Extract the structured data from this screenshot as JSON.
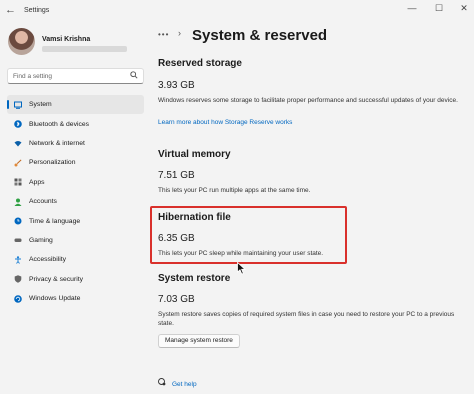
{
  "window": {
    "title": "Settings",
    "back": "←",
    "minimize": "—",
    "maximize": "☐",
    "close": "✕"
  },
  "profile": {
    "name": "Vamsi Krishna"
  },
  "search": {
    "placeholder": "Find a setting",
    "icon": "search-icon"
  },
  "sidebar": {
    "items": [
      {
        "label": "System",
        "icon": "system-icon",
        "color": "#0067c0"
      },
      {
        "label": "Bluetooth & devices",
        "icon": "bluetooth-icon",
        "color": "#0067c0"
      },
      {
        "label": "Network & internet",
        "icon": "wifi-icon",
        "color": "#0a5fa8"
      },
      {
        "label": "Personalization",
        "icon": "brush-icon",
        "color": "#c2691f"
      },
      {
        "label": "Apps",
        "icon": "apps-icon",
        "color": "#555555"
      },
      {
        "label": "Accounts",
        "icon": "person-icon",
        "color": "#2ea043"
      },
      {
        "label": "Time & language",
        "icon": "globe-clock-icon",
        "color": "#0067c0"
      },
      {
        "label": "Gaming",
        "icon": "controller-icon",
        "color": "#666666"
      },
      {
        "label": "Accessibility",
        "icon": "accessibility-icon",
        "color": "#1a7fd4"
      },
      {
        "label": "Privacy & security",
        "icon": "shield-icon",
        "color": "#666666"
      },
      {
        "label": "Windows Update",
        "icon": "update-icon",
        "color": "#0067c0"
      }
    ]
  },
  "header": {
    "dots": "•••",
    "chevron": "›",
    "title": "System & reserved"
  },
  "sections": {
    "reserved": {
      "title": "Reserved storage",
      "size": "3.93 GB",
      "desc": "Windows reserves some storage to facilitate proper performance and successful updates of your device.",
      "link": "Learn more about how Storage Reserve works"
    },
    "virtual": {
      "title": "Virtual memory",
      "size": "7.51 GB",
      "desc": "This lets your PC run multiple apps at the same time."
    },
    "hibernation": {
      "title": "Hibernation file",
      "size": "6.35 GB",
      "desc": "This lets your PC sleep while maintaining your user state."
    },
    "restore": {
      "title": "System restore",
      "size": "7.03 GB",
      "desc": "System restore saves copies of required system files in case you need to restore your PC to a previous state.",
      "button": "Manage system restore"
    }
  },
  "help": {
    "label": "Get help"
  },
  "colors": {
    "accent": "#0067c0",
    "highlight": "#d9302b",
    "background": "#f3f3f3"
  }
}
